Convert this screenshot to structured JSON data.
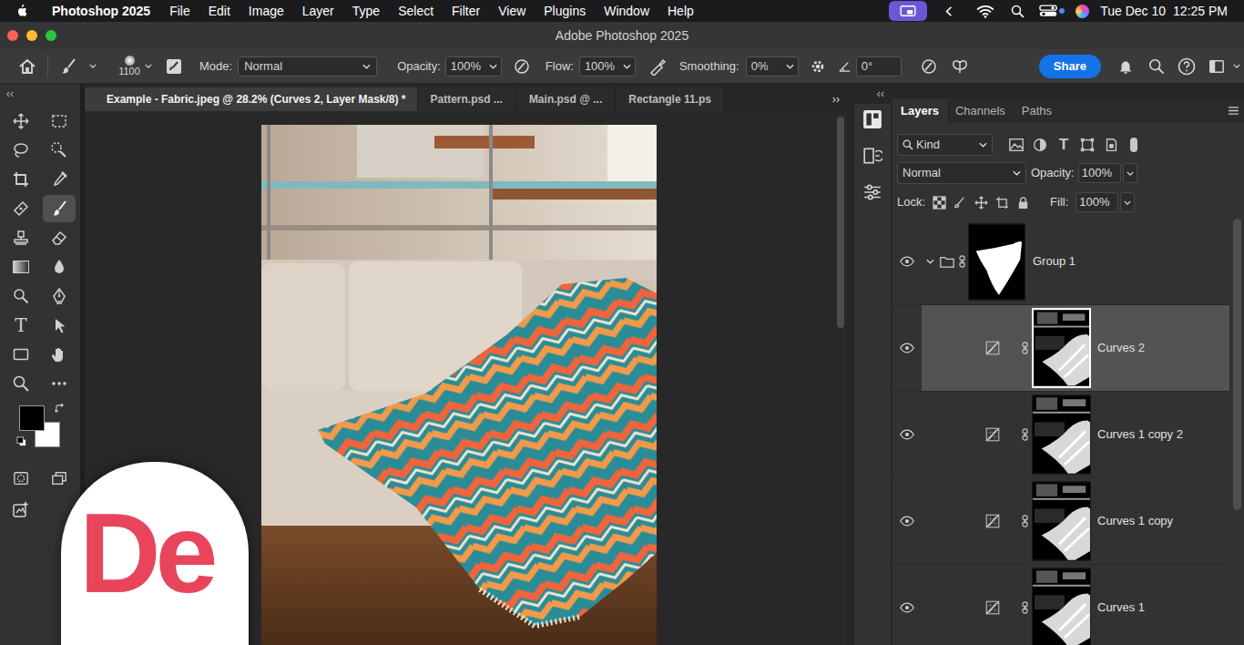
{
  "menubar": {
    "app": "Photoshop 2025",
    "items": [
      "File",
      "Edit",
      "Image",
      "Layer",
      "Type",
      "Select",
      "Filter",
      "View",
      "Plugins",
      "Window",
      "Help"
    ],
    "date": "Tue Dec 10",
    "time": "12:25 PM"
  },
  "window": {
    "title": "Adobe Photoshop 2025"
  },
  "options": {
    "brush_size": "1100",
    "mode_label": "Mode:",
    "mode": "Normal",
    "opacity_label": "Opacity:",
    "opacity": "100%",
    "flow_label": "Flow:",
    "flow": "100%",
    "smoothing_label": "Smoothing:",
    "smoothing": "0%",
    "angle": "0°",
    "share": "Share"
  },
  "toolbar": {
    "brush_selected": true,
    "type_glyph": "T"
  },
  "doc_tabs": [
    {
      "label": "Example - Fabric.jpeg @ 28.2% (Curves 2, Layer Mask/8) *",
      "selected": true
    },
    {
      "label": "Pattern.psd ...",
      "selected": false
    },
    {
      "label": "Main.psd @ ...",
      "selected": false
    },
    {
      "label": "Rectangle 11.ps",
      "selected": false
    }
  ],
  "panel_tabs": [
    {
      "label": "Layers",
      "selected": true
    },
    {
      "label": "Channels",
      "selected": false
    },
    {
      "label": "Paths",
      "selected": false
    }
  ],
  "layers_panel": {
    "filter": "Kind",
    "type_glyph": "T",
    "blend": "Normal",
    "opacity_label": "Opacity:",
    "opacity": "100%",
    "lock_label": "Lock:",
    "fill_label": "Fill:",
    "fill": "100%"
  },
  "layers": [
    {
      "name": "Group 1",
      "kind": "group",
      "visible": true,
      "selected": false,
      "expanded": true
    },
    {
      "name": "Curves 2",
      "kind": "curves",
      "visible": true,
      "selected": true
    },
    {
      "name": "Curves 1 copy 2",
      "kind": "curves",
      "visible": true,
      "selected": false
    },
    {
      "name": "Curves 1 copy",
      "kind": "curves",
      "visible": true,
      "selected": false
    },
    {
      "name": "Curves 1",
      "kind": "curves",
      "visible": true,
      "selected": false
    }
  ],
  "watermark": {
    "text": "De"
  }
}
